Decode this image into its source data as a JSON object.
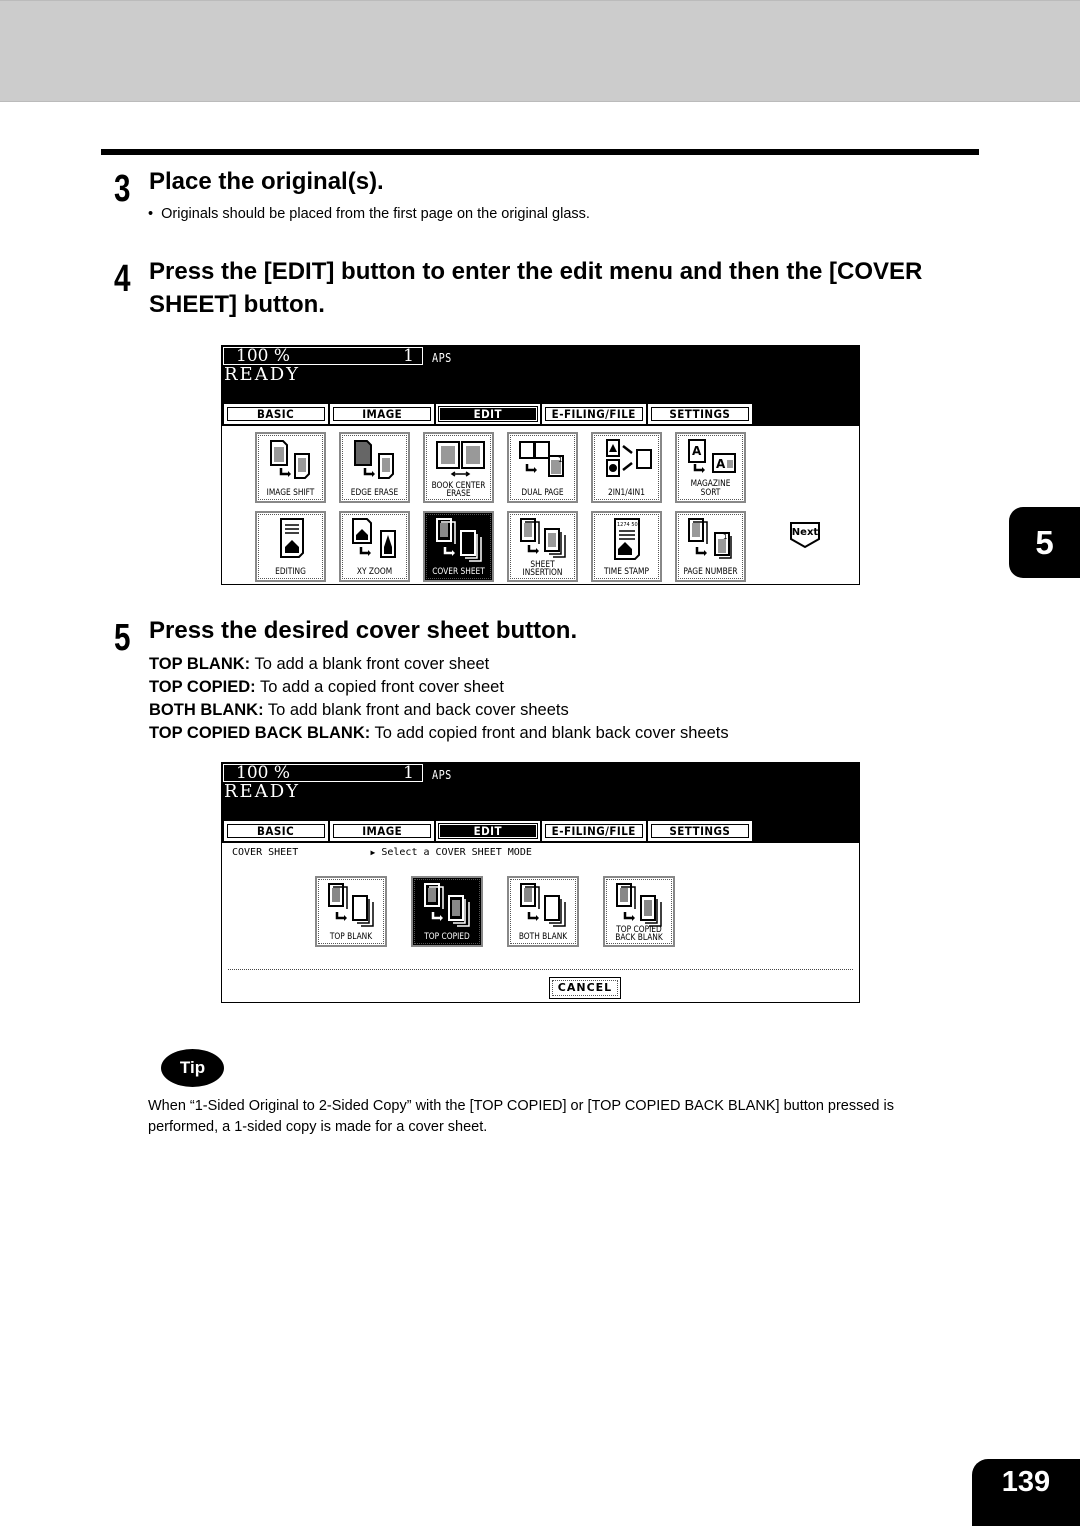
{
  "page": {
    "chapter_tab": "5",
    "page_number": "139"
  },
  "step3": {
    "number": "3",
    "title": "Place the original(s).",
    "bullet": "Originals should be placed from the first page on the original glass."
  },
  "step4": {
    "number": "4",
    "title": "Press the [EDIT] button to enter the edit menu and then the [COVER SHEET] button."
  },
  "panel": {
    "zoom": "100  %",
    "quantity": "1",
    "paper_mode": "APS",
    "status": "READY",
    "tabs": [
      {
        "label": "BASIC",
        "active": false
      },
      {
        "label": "IMAGE",
        "active": false
      },
      {
        "label": "EDIT",
        "active": true
      },
      {
        "label": "E-FILING/FILE",
        "active": false
      },
      {
        "label": "SETTINGS",
        "active": false
      }
    ]
  },
  "edit_menu": {
    "row1": [
      {
        "label": "IMAGE SHIFT"
      },
      {
        "label": "EDGE ERASE"
      },
      {
        "label": "BOOK CENTER ERASE"
      },
      {
        "label": "DUAL  PAGE"
      },
      {
        "label": "2IN1/4IN1"
      },
      {
        "label": "MAGAZINE SORT"
      }
    ],
    "row2": [
      {
        "label": "EDITING"
      },
      {
        "label": "XY ZOOM"
      },
      {
        "label": "COVER SHEET",
        "active": true
      },
      {
        "label": "SHEET INSERTION"
      },
      {
        "label": "TIME STAMP"
      },
      {
        "label": "PAGE NUMBER"
      }
    ],
    "next_label": "Next"
  },
  "step5": {
    "number": "5",
    "title": "Press the desired cover sheet button.",
    "descriptions": [
      {
        "term": "TOP BLANK:",
        "text": " To add a blank front cover sheet"
      },
      {
        "term": "TOP COPIED:",
        "text": " To add a copied front cover sheet"
      },
      {
        "term": "BOTH BLANK:",
        "text": " To add blank front and back cover sheets"
      },
      {
        "term": "TOP COPIED BACK BLANK:",
        "text": " To add copied front and blank back cover sheets"
      }
    ]
  },
  "cover_sheet_menu": {
    "title": "COVER SHEET",
    "prompt": "Select a COVER SHEET MODE",
    "options": [
      {
        "label": "TOP  BLANK",
        "active": false
      },
      {
        "label": "TOP COPIED",
        "active": true
      },
      {
        "label": "BOTH BLANK",
        "active": false
      },
      {
        "label": "TOP COPIED BACK BLANK",
        "active": false
      }
    ],
    "cancel_label": "CANCEL"
  },
  "tip": {
    "badge": "Tip",
    "text": "When “1-Sided Original to 2-Sided Copy” with the [TOP COPIED] or [TOP COPIED BACK BLANK] button pressed is performed, a 1-sided copy is made for a cover sheet."
  }
}
